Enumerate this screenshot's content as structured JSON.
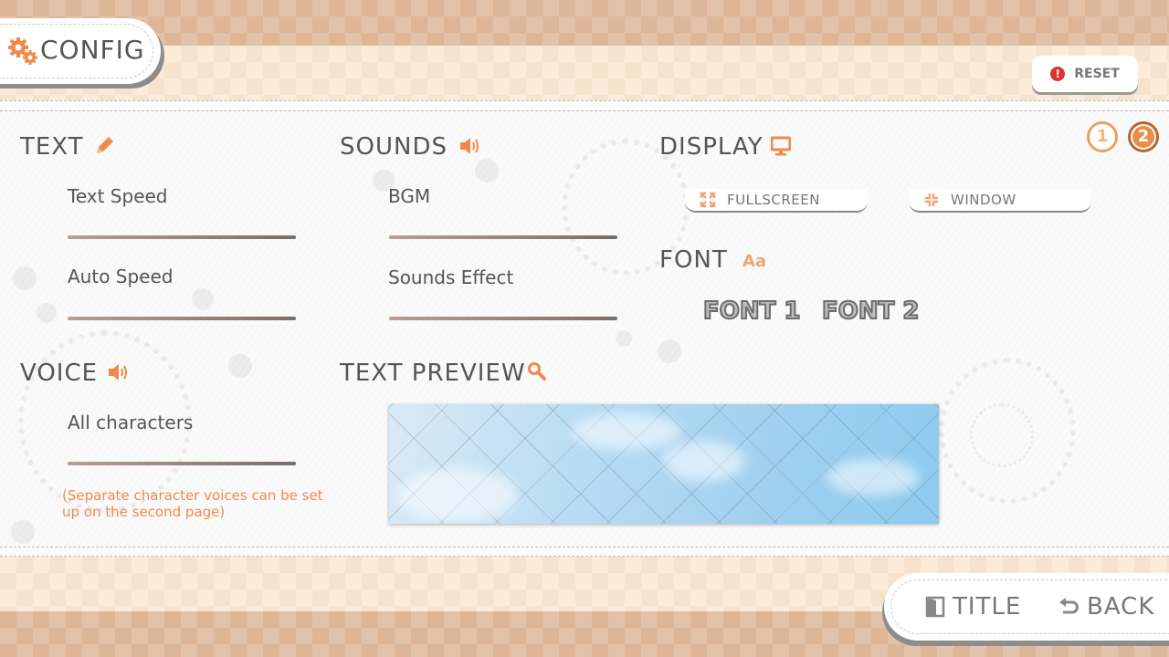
{
  "header": {
    "title": "CONFIG",
    "reset_label": "RESET"
  },
  "pages": [
    "1",
    "2"
  ],
  "text_section": {
    "heading": "TEXT",
    "settings": [
      {
        "label": "Text Speed"
      },
      {
        "label": "Auto Speed"
      }
    ]
  },
  "sounds_section": {
    "heading": "SOUNDS",
    "settings": [
      {
        "label": "BGM"
      },
      {
        "label": "Sounds Effect"
      }
    ]
  },
  "voice_section": {
    "heading": "VOICE",
    "settings": [
      {
        "label": "All characters"
      }
    ],
    "note": "(Separate character voices can be set up on the second page)"
  },
  "display_section": {
    "heading": "DISPLAY",
    "fullscreen_label": "FULLSCREEN",
    "window_label": "WINDOW"
  },
  "font_section": {
    "heading": "FONT",
    "icon_text": "Aa",
    "options": [
      "FONT 1",
      "FONT 2"
    ]
  },
  "preview_section": {
    "heading": "TEXT PREVIEW"
  },
  "nav": {
    "title_label": "TITLE",
    "back_label": "BACK"
  },
  "icons": {
    "config": "gears-icon",
    "reset": "alert-icon",
    "text": "pencil-icon",
    "sounds": "speaker-icon",
    "voice": "speaker-icon",
    "display": "monitor-icon",
    "fullscreen": "expand-icon",
    "window": "compress-icon",
    "preview": "magnifier-icon",
    "title": "door-icon",
    "back": "undo-arrow-icon"
  },
  "colors": {
    "accent": "#f2884e",
    "band_dark": "#ddb597",
    "band_light": "#fdebd9",
    "text": "#555555",
    "reset_icon": "#dd3333"
  }
}
